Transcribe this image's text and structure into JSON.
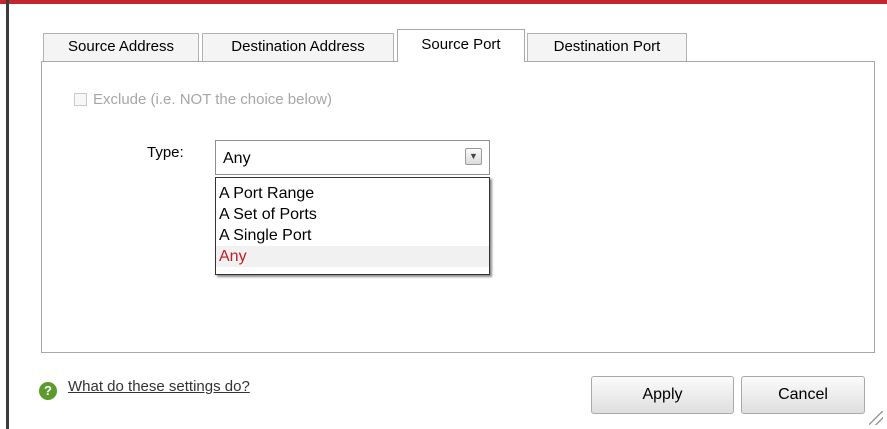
{
  "tabs": [
    {
      "label": "Source Address"
    },
    {
      "label": "Destination Address"
    },
    {
      "label": "Source Port"
    },
    {
      "label": "Destination Port"
    }
  ],
  "active_tab": "Source Port",
  "exclude": {
    "label": "Exclude (i.e. NOT the choice below)",
    "checked": false,
    "disabled": true
  },
  "type_field": {
    "label": "Type:",
    "value": "Any",
    "options": [
      "A Port Range",
      "A Set of Ports",
      "A Single Port",
      "Any"
    ],
    "selected": "Any"
  },
  "help": {
    "icon": "question-icon",
    "link_text": "What do these settings do?"
  },
  "buttons": {
    "apply": "Apply",
    "cancel": "Cancel"
  },
  "colors": {
    "accent": "#c4262e",
    "selected_option_text": "#c01e22",
    "help_icon": "#5b9b2b"
  }
}
